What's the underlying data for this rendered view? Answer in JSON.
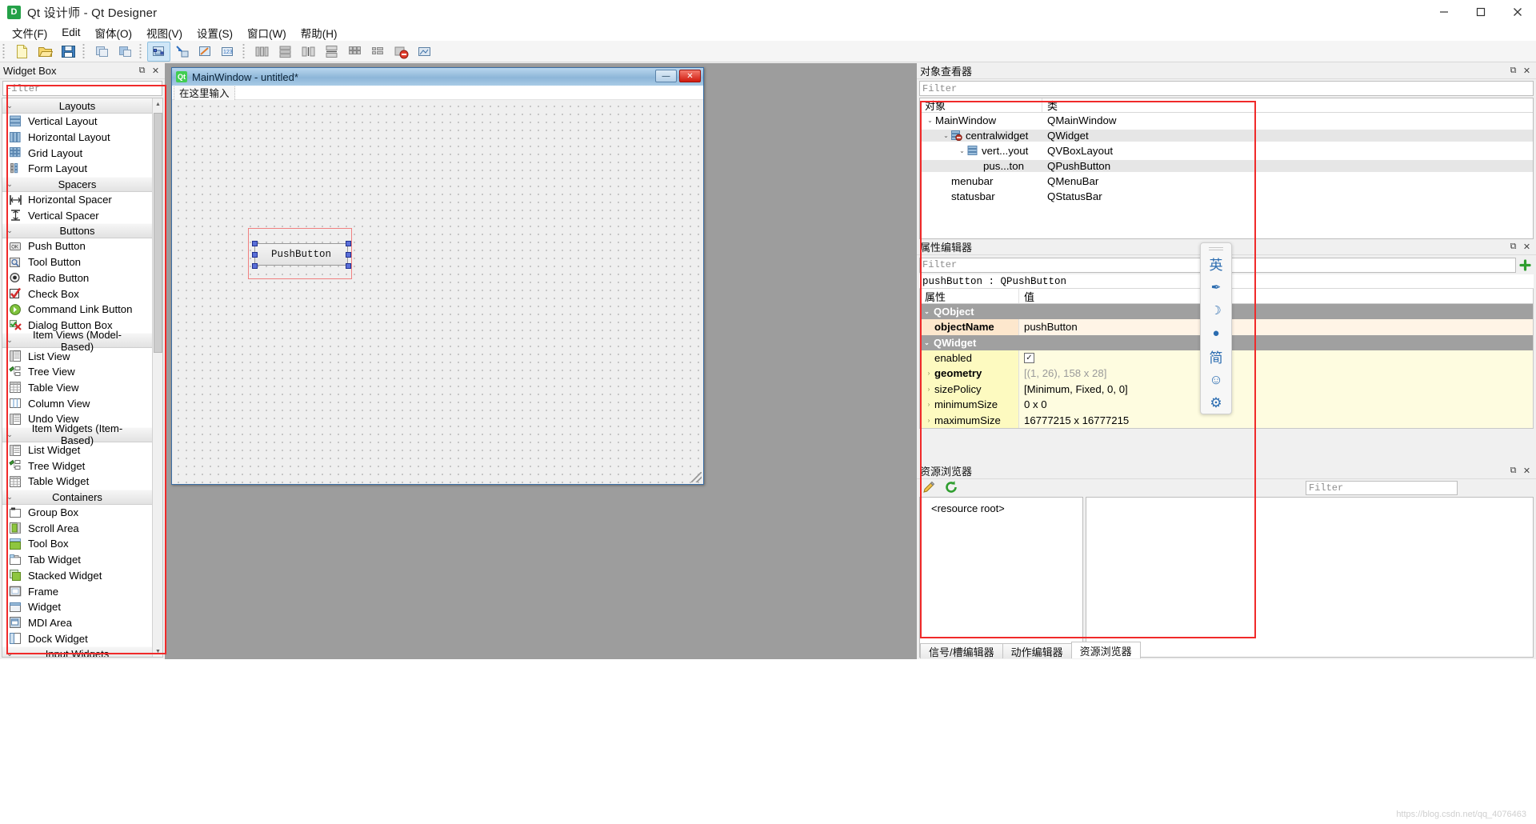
{
  "window": {
    "title": "Qt 设计师 - Qt Designer",
    "icon": "D",
    "minimize_label": "—",
    "maximize_label": "▢",
    "close_label": "✕"
  },
  "menubar": {
    "items": [
      {
        "label": "文件(F)",
        "mnemonic": "F"
      },
      {
        "label": "Edit",
        "mnemonic": "E"
      },
      {
        "label": "窗体(O)",
        "mnemonic": "O"
      },
      {
        "label": "视图(V)",
        "mnemonic": "V"
      },
      {
        "label": "设置(S)",
        "mnemonic": "S"
      },
      {
        "label": "窗口(W)",
        "mnemonic": "W"
      },
      {
        "label": "帮助(H)",
        "mnemonic": "H"
      }
    ]
  },
  "toolbar": {
    "groups": [
      {
        "buttons": [
          {
            "name": "new-form-icon",
            "glyph": "📄"
          },
          {
            "name": "open-form-icon",
            "glyph": "📂"
          },
          {
            "name": "save-form-icon",
            "glyph": "💾"
          }
        ]
      },
      {
        "buttons": [
          {
            "name": "undo-icon",
            "glyph": "◰"
          },
          {
            "name": "redo-icon",
            "glyph": "◳"
          }
        ]
      },
      {
        "buttons": [
          {
            "name": "edit-widgets-icon",
            "glyph": "◱",
            "active": true
          },
          {
            "name": "edit-signals-slots-icon",
            "glyph": "⬓"
          },
          {
            "name": "edit-buddies-icon",
            "glyph": "◨"
          },
          {
            "name": "edit-tab-order-icon",
            "glyph": "123"
          }
        ]
      },
      {
        "buttons": [
          {
            "name": "layout-horizontally-icon",
            "glyph": "▥"
          },
          {
            "name": "layout-vertically-icon",
            "glyph": "▤"
          },
          {
            "name": "layout-in-splitter-h-icon",
            "glyph": "⧉"
          },
          {
            "name": "layout-in-splitter-v-icon",
            "glyph": "⧈"
          },
          {
            "name": "layout-grid-icon",
            "glyph": "▦"
          },
          {
            "name": "layout-form-icon",
            "glyph": "▩"
          },
          {
            "name": "break-layout-icon",
            "glyph": "⊘"
          },
          {
            "name": "adjust-size-icon",
            "glyph": "⤢"
          }
        ]
      }
    ]
  },
  "widget_box": {
    "title": "Widget Box",
    "filter_placeholder": "Filter",
    "float_label": "⧉",
    "close_label": "✕",
    "scroll_up": "▲",
    "scroll_down": "▼",
    "groups": [
      {
        "label": "Layouts",
        "chevron": "⌄",
        "items": [
          {
            "label": "Vertical Layout",
            "icon": "vertical-layout-icon"
          },
          {
            "label": "Horizontal Layout",
            "icon": "horizontal-layout-icon"
          },
          {
            "label": "Grid Layout",
            "icon": "grid-layout-icon"
          },
          {
            "label": "Form Layout",
            "icon": "form-layout-icon"
          }
        ]
      },
      {
        "label": "Spacers",
        "chevron": "⌄",
        "items": [
          {
            "label": "Horizontal Spacer",
            "icon": "horizontal-spacer-icon"
          },
          {
            "label": "Vertical Spacer",
            "icon": "vertical-spacer-icon"
          }
        ]
      },
      {
        "label": "Buttons",
        "chevron": "⌄",
        "items": [
          {
            "label": "Push Button",
            "icon": "push-button-icon"
          },
          {
            "label": "Tool Button",
            "icon": "tool-button-icon"
          },
          {
            "label": "Radio Button",
            "icon": "radio-button-icon"
          },
          {
            "label": "Check Box",
            "icon": "check-box-icon"
          },
          {
            "label": "Command Link Button",
            "icon": "command-link-button-icon"
          },
          {
            "label": "Dialog Button Box",
            "icon": "dialog-button-box-icon"
          }
        ]
      },
      {
        "label": "Item Views (Model-Based)",
        "chevron": "⌄",
        "items": [
          {
            "label": "List View",
            "icon": "list-view-icon"
          },
          {
            "label": "Tree View",
            "icon": "tree-view-icon"
          },
          {
            "label": "Table View",
            "icon": "table-view-icon"
          },
          {
            "label": "Column View",
            "icon": "column-view-icon"
          },
          {
            "label": "Undo View",
            "icon": "undo-view-icon"
          }
        ]
      },
      {
        "label": "Item Widgets (Item-Based)",
        "chevron": "⌄",
        "items": [
          {
            "label": "List Widget",
            "icon": "list-widget-icon"
          },
          {
            "label": "Tree Widget",
            "icon": "tree-widget-icon"
          },
          {
            "label": "Table Widget",
            "icon": "table-widget-icon"
          }
        ]
      },
      {
        "label": "Containers",
        "chevron": "⌄",
        "items": [
          {
            "label": "Group Box",
            "icon": "group-box-icon"
          },
          {
            "label": "Scroll Area",
            "icon": "scroll-area-icon"
          },
          {
            "label": "Tool Box",
            "icon": "tool-box-icon"
          },
          {
            "label": "Tab Widget",
            "icon": "tab-widget-icon"
          },
          {
            "label": "Stacked Widget",
            "icon": "stacked-widget-icon"
          },
          {
            "label": "Frame",
            "icon": "frame-icon"
          },
          {
            "label": "Widget",
            "icon": "widget-icon"
          },
          {
            "label": "MDI Area",
            "icon": "mdi-area-icon"
          },
          {
            "label": "Dock Widget",
            "icon": "dock-widget-icon"
          }
        ]
      },
      {
        "label": "Input Widgets",
        "chevron": "⌄",
        "items": []
      }
    ]
  },
  "form": {
    "title": "MainWindow - untitled*",
    "icon_text": "Qt",
    "minimize_label": "—",
    "close_label": "✕",
    "menu_hint": "在这里输入",
    "button_text": "PushButton"
  },
  "object_inspector": {
    "title": "对象查看器",
    "float_label": "⧉",
    "close_label": "✕",
    "filter_placeholder": "Filter",
    "columns": [
      "对象",
      "类"
    ],
    "rows": [
      {
        "name": "MainWindow",
        "class": "QMainWindow",
        "depth": 0,
        "chevron": "⌄",
        "icon": "",
        "selected": false
      },
      {
        "name": "centralwidget",
        "class": "QWidget",
        "depth": 1,
        "chevron": "⌄",
        "icon": "no-layout-icon",
        "selected": true
      },
      {
        "name": "vert...yout",
        "class": "QVBoxLayout",
        "depth": 2,
        "chevron": "⌄",
        "icon": "vertical-layout-icon",
        "selected": false
      },
      {
        "name": "pus...ton",
        "class": "QPushButton",
        "depth": 3,
        "chevron": "",
        "icon": "",
        "selected": true
      },
      {
        "name": "menubar",
        "class": "QMenuBar",
        "depth": 1,
        "chevron": "",
        "icon": "",
        "selected": false
      },
      {
        "name": "statusbar",
        "class": "QStatusBar",
        "depth": 1,
        "chevron": "",
        "icon": "",
        "selected": false
      }
    ]
  },
  "property_editor": {
    "title": "属性编辑器",
    "float_label": "⧉",
    "close_label": "✕",
    "filter_placeholder": "Filter",
    "add_button": "＋",
    "subject": "pushButton : QPushButton",
    "columns": [
      "属性",
      "值"
    ],
    "groups": [
      {
        "name": "QObject",
        "chevron": "⌄",
        "rows": [
          {
            "name": "objectName",
            "value": "pushButton",
            "color": "orange",
            "bold": true,
            "expandable": false,
            "greyvalue": false
          }
        ]
      },
      {
        "name": "QWidget",
        "chevron": "⌄",
        "rows": [
          {
            "name": "enabled",
            "value": "",
            "color": "yellow",
            "bold": false,
            "expandable": false,
            "checkbox": true,
            "checked": true
          },
          {
            "name": "geometry",
            "value": "[(1, 26), 158 x 28]",
            "color": "yellow",
            "bold": true,
            "expandable": true,
            "greyvalue": true
          },
          {
            "name": "sizePolicy",
            "value": "[Minimum, Fixed, 0, 0]",
            "color": "yellow",
            "bold": false,
            "expandable": true,
            "greyvalue": false
          },
          {
            "name": "minimumSize",
            "value": "0 x 0",
            "color": "yellow",
            "bold": false,
            "expandable": true,
            "greyvalue": false
          },
          {
            "name": "maximumSize",
            "value": "16777215 x 16777215",
            "color": "yellow",
            "bold": false,
            "expandable": true,
            "greyvalue": false
          }
        ]
      }
    ]
  },
  "resource_browser": {
    "title": "资源浏览器",
    "float_label": "⧉",
    "close_label": "✕",
    "edit_icon": "✏",
    "reload_icon": "⟳",
    "filter_placeholder": "Filter",
    "root_label": "<resource root>"
  },
  "bottom_tabs": [
    {
      "label": "信号/槽编辑器",
      "active": false
    },
    {
      "label": "动作编辑器",
      "active": false
    },
    {
      "label": "资源浏览器",
      "active": true
    }
  ],
  "ime_bar": {
    "items": [
      {
        "name": "ime-lang-english",
        "glyph": "英"
      },
      {
        "name": "ime-pen",
        "glyph": "✒"
      },
      {
        "name": "ime-moon",
        "glyph": "☽"
      },
      {
        "name": "ime-punctuation",
        "glyph": "●"
      },
      {
        "name": "ime-simplified",
        "glyph": "简"
      },
      {
        "name": "ime-emoji",
        "glyph": "☺"
      },
      {
        "name": "ime-settings",
        "glyph": "⚙"
      }
    ]
  },
  "watermark": "https://blog.csdn.net/qq_4076463"
}
